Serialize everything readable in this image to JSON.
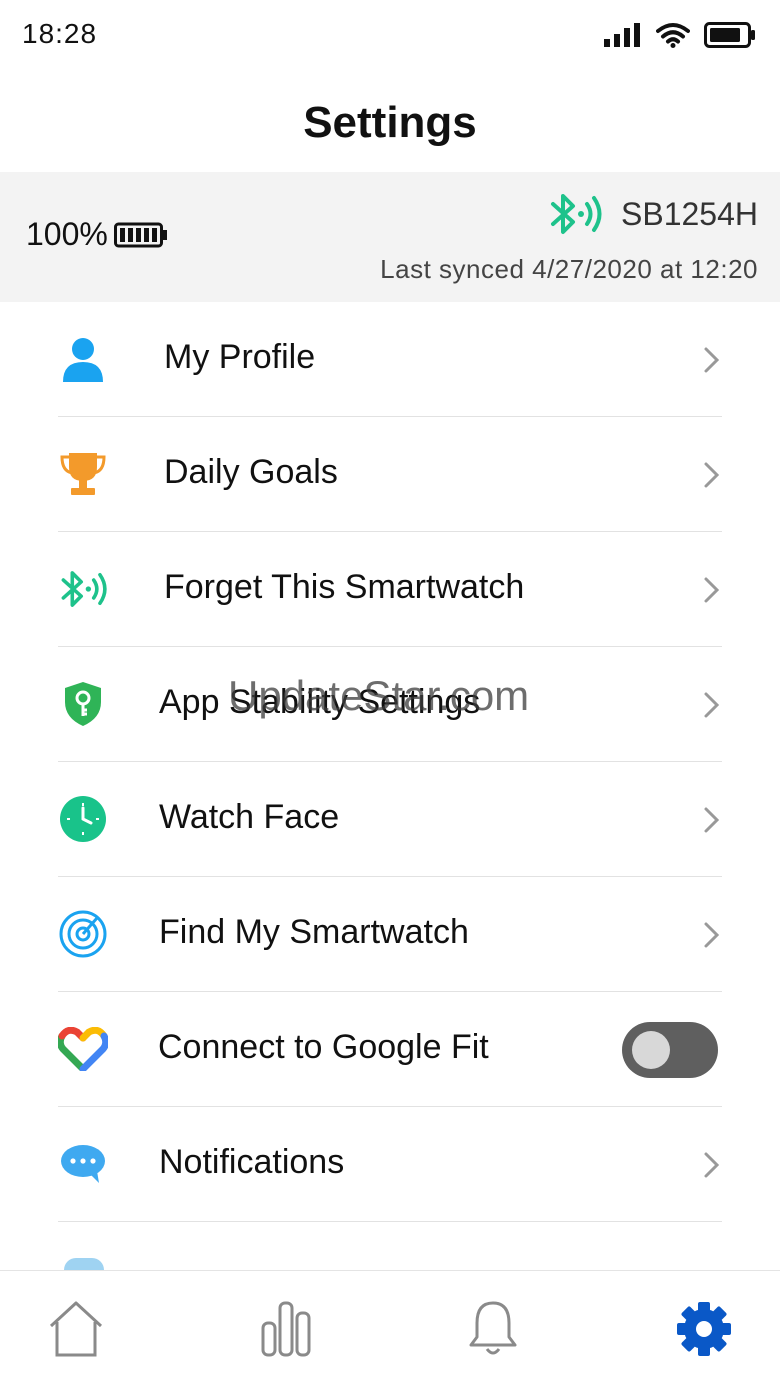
{
  "status_bar": {
    "time": "18:28"
  },
  "page": {
    "title": "Settings"
  },
  "device": {
    "battery": "100%",
    "name": "SB1254H",
    "last_synced": "Last synced  4/27/2020 at 12:20"
  },
  "menu": [
    {
      "label": "My Profile",
      "icon": "person-icon",
      "type": "chevron"
    },
    {
      "label": "Daily Goals",
      "icon": "trophy-icon",
      "type": "chevron"
    },
    {
      "label": "Forget This Smartwatch",
      "icon": "bluetooth-icon",
      "type": "chevron"
    },
    {
      "label": "App Stability Settings",
      "icon": "shield-key-icon",
      "type": "chevron"
    },
    {
      "label": "Watch Face",
      "icon": "clock-icon",
      "type": "chevron"
    },
    {
      "label": "Find My Smartwatch",
      "icon": "radar-icon",
      "type": "chevron"
    },
    {
      "label": "Connect to Google Fit",
      "icon": "google-fit-icon",
      "type": "toggle",
      "toggle_on": false
    },
    {
      "label": "Notifications",
      "icon": "chat-bubble-icon",
      "type": "chevron"
    }
  ],
  "watermark": "UpdateStar.com",
  "bottom_nav": [
    {
      "name": "home-icon",
      "active": false
    },
    {
      "name": "stats-icon",
      "active": false
    },
    {
      "name": "bell-icon",
      "active": false
    },
    {
      "name": "gear-icon",
      "active": true
    }
  ],
  "colors": {
    "accent_blue": "#0a58c7",
    "bluetooth_green": "#1ec28b",
    "trophy_orange": "#f39a2b",
    "profile_blue": "#1aa3f0"
  }
}
